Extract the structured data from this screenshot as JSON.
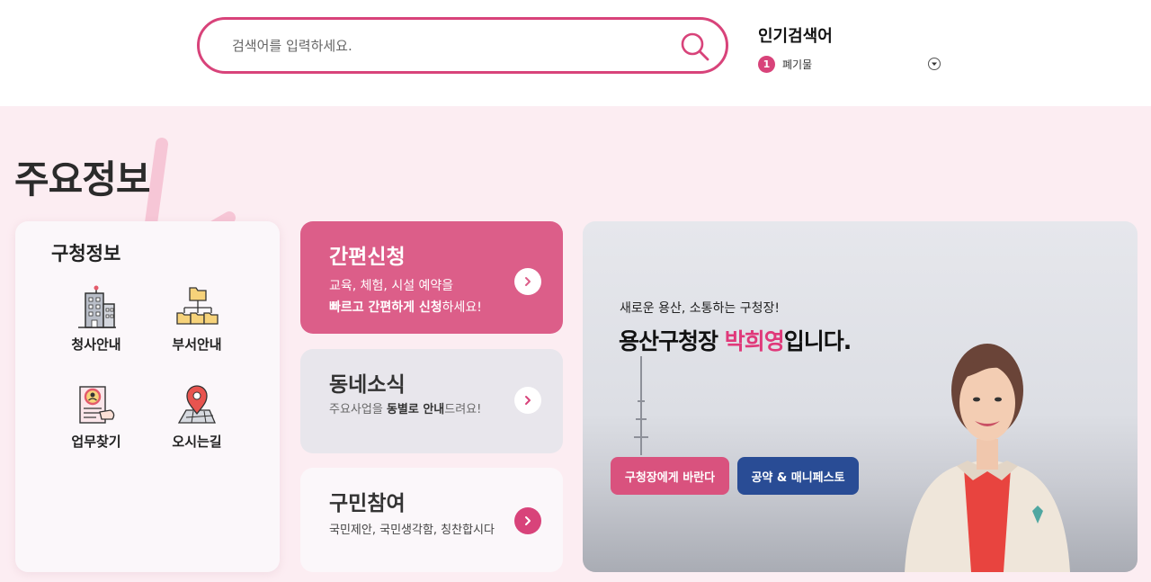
{
  "search": {
    "placeholder": "검색어를 입력하세요."
  },
  "popular": {
    "title": "인기검색어",
    "rank": "1",
    "keyword": "폐기물"
  },
  "section": {
    "title": "주요정보"
  },
  "info_card": {
    "title": "구청정보",
    "items": [
      {
        "label": "청사안내",
        "icon": "building-icon"
      },
      {
        "label": "부서안내",
        "icon": "org-chart-icon"
      },
      {
        "label": "업무찾기",
        "icon": "search-document-icon"
      },
      {
        "label": "오시는길",
        "icon": "map-pin-icon"
      }
    ]
  },
  "services": [
    {
      "title": "간편신청",
      "desc_line1": "교육, 체험, 시설 예약을",
      "desc_bold": "빠르고 간편하게 신청",
      "desc_tail": "하세요!"
    },
    {
      "title": "동네소식",
      "desc_pre": "주요사업을 ",
      "desc_bold": "동별로 안내",
      "desc_tail": "드려요!"
    },
    {
      "title": "구민참여",
      "desc": "국민제안, 국민생각함, 칭찬합시다"
    }
  ],
  "mayor": {
    "subtitle": "새로운 용산, 소통하는 구청장!",
    "headline_pre": "용산구청장 ",
    "headline_name": "박희영",
    "headline_post": "입니다.",
    "button_contact": "구청장에게 바란다",
    "button_manifesto": "공약 & 매니페스토"
  },
  "colors": {
    "accent_pink": "#d8437a",
    "card_pink": "#dc5e89",
    "navy": "#294c95",
    "background_pink": "#fcedf2"
  }
}
